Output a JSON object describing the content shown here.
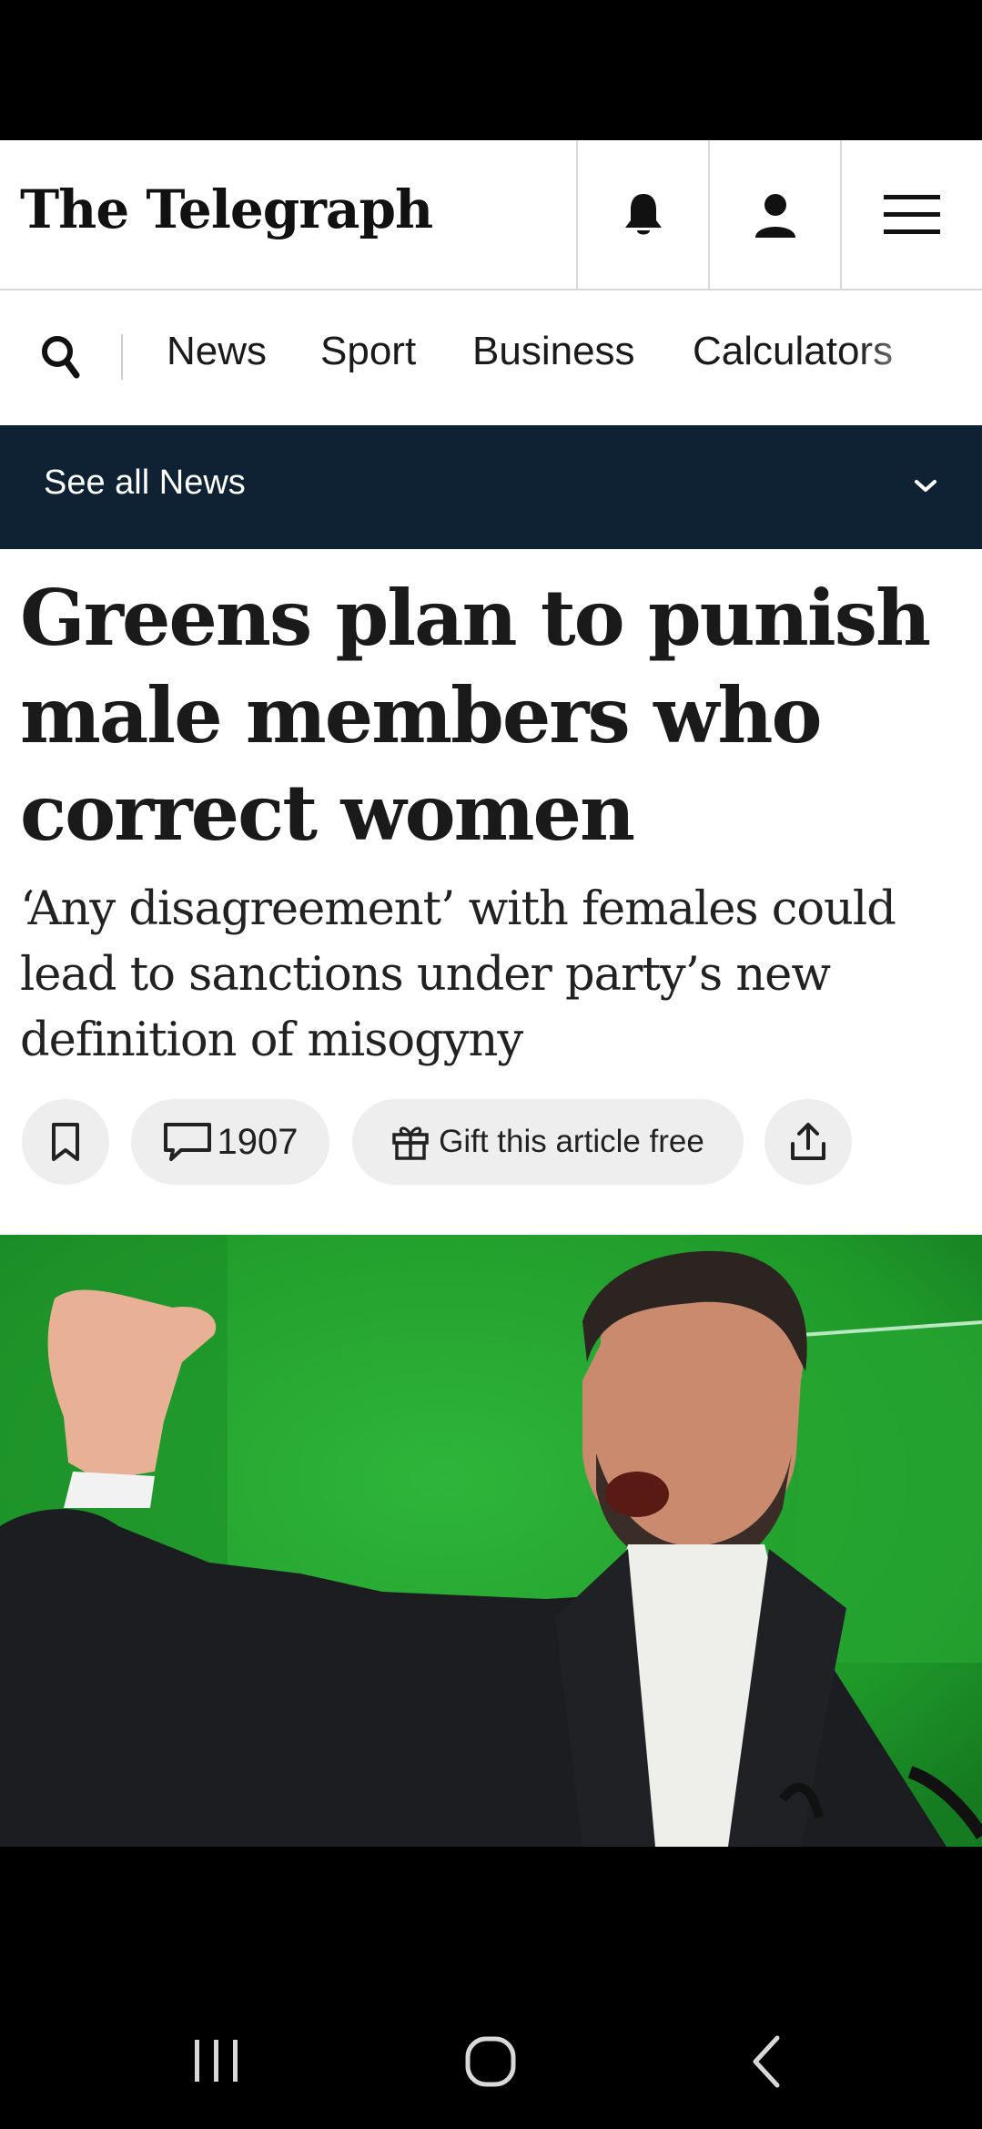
{
  "masthead": {
    "logo": "The Telegraph",
    "buttons": [
      {
        "icon": "bell-icon"
      },
      {
        "icon": "user-icon"
      },
      {
        "icon": "hamburger-menu-icon"
      }
    ]
  },
  "nav": {
    "search_icon": "search-icon",
    "items": [
      "News",
      "Sport",
      "Business",
      "Calculators"
    ]
  },
  "section_bar": {
    "label": "See all News",
    "chevron_icon": "chevron-down-icon"
  },
  "article": {
    "headline": "Greens plan to punish male members who correct women",
    "standfirst": "‘Any disagreement’ with females could lead to sanctions under party’s new definition of misogyny",
    "actions": {
      "bookmark_icon": "bookmark-icon",
      "comment_count": "1907",
      "gift_label": "Gift this article free",
      "share_icon": "share-icon"
    }
  },
  "hero_image": {
    "background_color": "#23a02f"
  },
  "system_nav": {
    "buttons": [
      "recents-icon",
      "home-icon",
      "back-icon"
    ]
  },
  "colors": {
    "section_bar": "#0f2233",
    "action_pill": "#eeeeee",
    "text": "#1a1a1a"
  }
}
